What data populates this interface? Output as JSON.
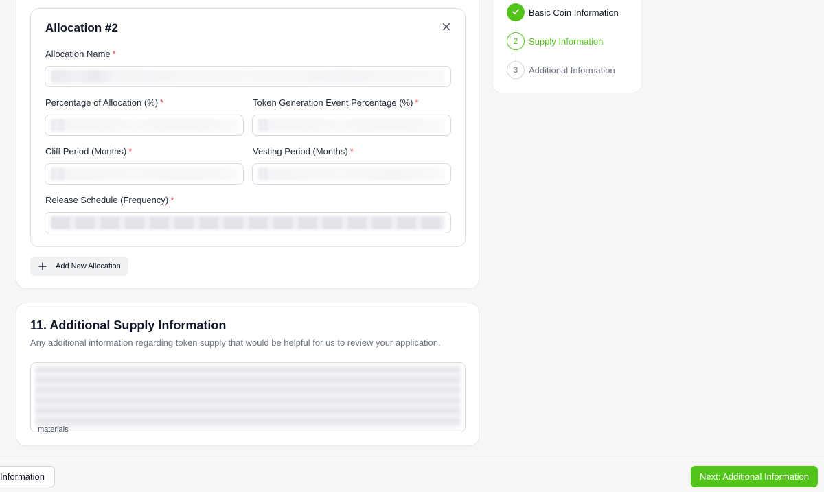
{
  "allocation": {
    "title": "Allocation #2",
    "close_icon": "close-icon",
    "fields": {
      "name": {
        "label": "Allocation Name",
        "required": "*"
      },
      "percentage": {
        "label": "Percentage of Allocation (%)",
        "required": "*"
      },
      "tge": {
        "label": "Token Generation Event Percentage (%)",
        "required": "*"
      },
      "cliff": {
        "label": "Cliff Period (Months)",
        "required": "*"
      },
      "vesting": {
        "label": "Vesting Period (Months)",
        "required": "*"
      },
      "release": {
        "label": "Release Schedule (Frequency)",
        "required": "*"
      }
    },
    "add_button": {
      "label": "Add New Allocation",
      "icon": "plus-icon"
    }
  },
  "supply_section": {
    "title": "11. Additional Supply Information",
    "description": "Any additional information regarding token supply that would be helpful for us to review your application.",
    "textarea_tail": "materials"
  },
  "stepper": {
    "steps": [
      {
        "number": "",
        "label": "Basic Coin Information",
        "state": "done",
        "icon": "check-icon"
      },
      {
        "number": "2",
        "label": "Supply Information",
        "state": "active"
      },
      {
        "number": "3",
        "label": "Additional Information",
        "state": "idle"
      }
    ]
  },
  "footer": {
    "prev_label": "Information",
    "next_label": "Next: Additional Information"
  },
  "colors": {
    "accent": "#52c41a",
    "required": "#ef4444",
    "muted_text": "#6b7280"
  }
}
